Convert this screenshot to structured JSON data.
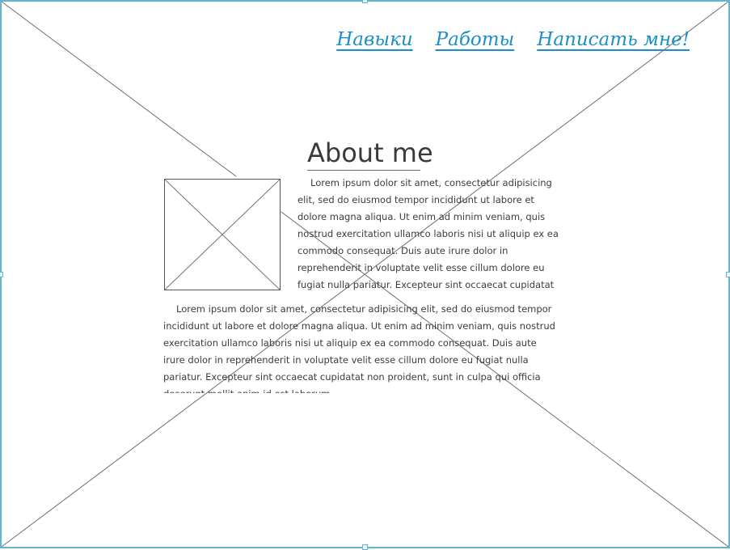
{
  "nav": {
    "skills": "Навыки",
    "works": "Работы",
    "contact": "Написать мне!"
  },
  "about": {
    "title": "About me",
    "paragraph_1": "Lorem ipsum dolor sit amet, consectetur adipisicing elit, sed do eiusmod tempor incididunt ut labore et dolore magna aliqua. Ut enim ad minim veniam, quis nostrud exercitation ullamco laboris nisi ut aliquip ex ea commodo consequat. Duis aute irure dolor in reprehenderit in voluptate velit esse cillum dolore eu fugiat nulla pariatur. Excepteur sint occaecat cupidatat non proident, sunt in culpa qui officia",
    "paragraph_2": "Lorem ipsum dolor sit amet, consectetur adipisicing elit, sed do eiusmod tempor incididunt ut labore et dolore magna aliqua. Ut enim ad minim veniam, quis nostrud exercitation ullamco laboris nisi ut aliquip ex ea commodo consequat. Duis aute irure dolor in reprehenderit in voluptate velit esse cillum dolore eu fugiat nulla pariatur. Excepteur sint occaecat cupidatat non proident, sunt in culpa qui officia deserunt mollit anim id est laborum."
  },
  "colors": {
    "link": "#1a8fc9",
    "frame": "#64b6cf",
    "text": "#3c3c3c"
  }
}
